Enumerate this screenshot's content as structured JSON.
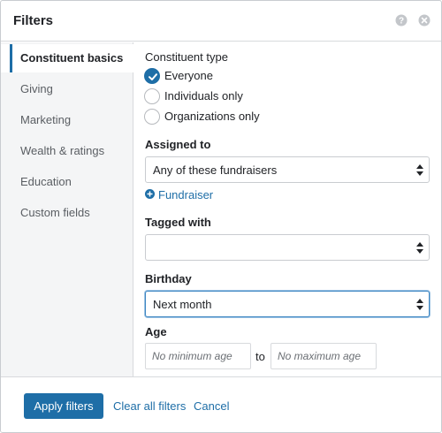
{
  "dialog": {
    "title": "Filters",
    "help_icon": "help-circle-icon",
    "close_icon": "close-circle-icon"
  },
  "sidebar": {
    "items": [
      {
        "label": "Constituent basics",
        "active": true
      },
      {
        "label": "Giving"
      },
      {
        "label": "Marketing"
      },
      {
        "label": "Wealth & ratings"
      },
      {
        "label": "Education"
      },
      {
        "label": "Custom fields"
      }
    ]
  },
  "constituent_type": {
    "label": "Constituent type",
    "options": [
      {
        "label": "Everyone",
        "checked": true
      },
      {
        "label": "Individuals only",
        "checked": false
      },
      {
        "label": "Organizations only",
        "checked": false
      }
    ]
  },
  "assigned_to": {
    "label": "Assigned to",
    "value": "Any of these fundraisers",
    "add_link": "Fundraiser"
  },
  "tagged_with": {
    "label": "Tagged with",
    "value": ""
  },
  "birthday": {
    "label": "Birthday",
    "value": "Next month"
  },
  "age": {
    "label": "Age",
    "min_placeholder": "No minimum age",
    "to_text": "to",
    "max_placeholder": "No maximum age"
  },
  "footer": {
    "apply_label": "Apply filters",
    "clear_label": "Clear all filters",
    "cancel_label": "Cancel"
  },
  "colors": {
    "accent": "#1e6ea7",
    "sidebar_bg": "#f4f5f6",
    "border": "#c9ccd0"
  }
}
